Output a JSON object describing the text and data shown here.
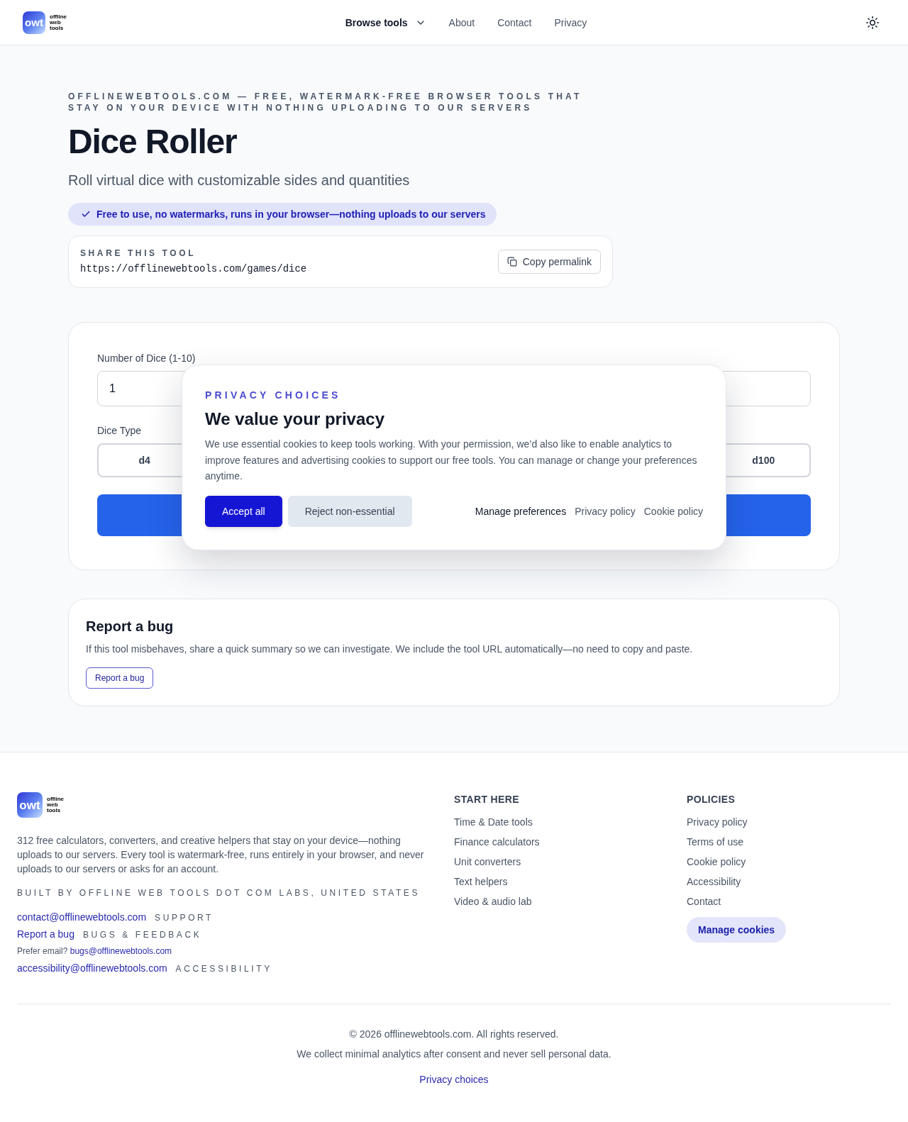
{
  "header": {
    "logo": {
      "mark": "owt",
      "wordmark": "offline web tools"
    },
    "nav": [
      {
        "label": "Browse tools",
        "kind": "dropdown"
      },
      {
        "label": "About",
        "kind": "link"
      },
      {
        "label": "Contact",
        "kind": "link"
      },
      {
        "label": "Privacy",
        "kind": "link"
      }
    ]
  },
  "hero": {
    "eyebrow": "OFFLINEWEBTOOLS.COM — FREE, WATERMARK-FREE BROWSER TOOLS THAT STAY ON YOUR DEVICE WITH NOTHING UPLOADING TO OUR SERVERS",
    "title": "Dice Roller",
    "subtitle": "Roll virtual dice with customizable sides and quantities",
    "badge": "Free to use, no watermarks, runs in your browser—nothing uploads to our servers"
  },
  "share": {
    "label": "SHARE THIS TOOL",
    "url": "https://offlinewebtools.com/games/dice",
    "button": "Copy permalink"
  },
  "tool": {
    "count_field": {
      "label": "Number of Dice (1-10)",
      "value": "1"
    },
    "dice_type": {
      "label": "Dice Type",
      "options": [
        {
          "label": "d4",
          "selected": false
        },
        {
          "label": "d100",
          "selected": false
        }
      ]
    }
  },
  "report": {
    "title": "Report a bug",
    "text": "If this tool misbehaves, share a quick summary so we can investigate. We include the tool URL automatically—no need to copy and paste.",
    "button": "Report a bug"
  },
  "footer": {
    "logo": {
      "mark": "owt",
      "wordmark": "offline web tools"
    },
    "description": "312 free calculators, converters, and creative helpers that stay on your device—nothing uploads to our servers. Every tool is watermark-free, runs entirely in your browser, and never uploads to our servers or asks for an account.",
    "built_by": "BUILT BY OFFLINE WEB TOOLS DOT COM LABS, UNITED STATES",
    "contacts": [
      {
        "kind": "tagged",
        "link": "contact@offlinewebtools.com",
        "tag": "SUPPORT"
      },
      {
        "kind": "tagged",
        "link": "Report a bug",
        "tag": "BUGS & FEEDBACK"
      },
      {
        "kind": "note",
        "text": "Prefer email?",
        "link": "bugs@offlinewebtools.com"
      },
      {
        "kind": "tagged",
        "link": "accessibility@offlinewebtools.com",
        "tag": "ACCESSIBILITY"
      }
    ],
    "columns": [
      {
        "heading": "START HERE",
        "links": [
          "Time & Date tools",
          "Finance calculators",
          "Unit converters",
          "Text helpers",
          "Video & audio lab"
        ]
      },
      {
        "heading": "POLICIES",
        "links": [
          "Privacy policy",
          "Terms of use",
          "Cookie policy",
          "Accessibility",
          "Contact"
        ],
        "button": "Manage cookies"
      }
    ],
    "bottom": {
      "copyright": "© 2026 offlinewebtools.com. All rights reserved.",
      "note": "We collect minimal analytics after consent and never sell personal data.",
      "link": "Privacy choices"
    }
  },
  "consent_dialog": {
    "eyebrow": "PRIVACY CHOICES",
    "title": "We value your privacy",
    "text": "We use essential cookies to keep tools working. With your permission, we’d also like to enable analytics to improve features and advertising cookies to support our free tools. You can manage or change your preferences anytime.",
    "actions": [
      {
        "label": "Accept all",
        "kind": "primary"
      },
      {
        "label": "Reject non-essential",
        "kind": "secondary"
      },
      {
        "label": "Manage preferences",
        "kind": "strong-link"
      },
      {
        "label": "Privacy policy",
        "kind": "link"
      },
      {
        "label": "Cookie policy",
        "kind": "link"
      }
    ]
  }
}
